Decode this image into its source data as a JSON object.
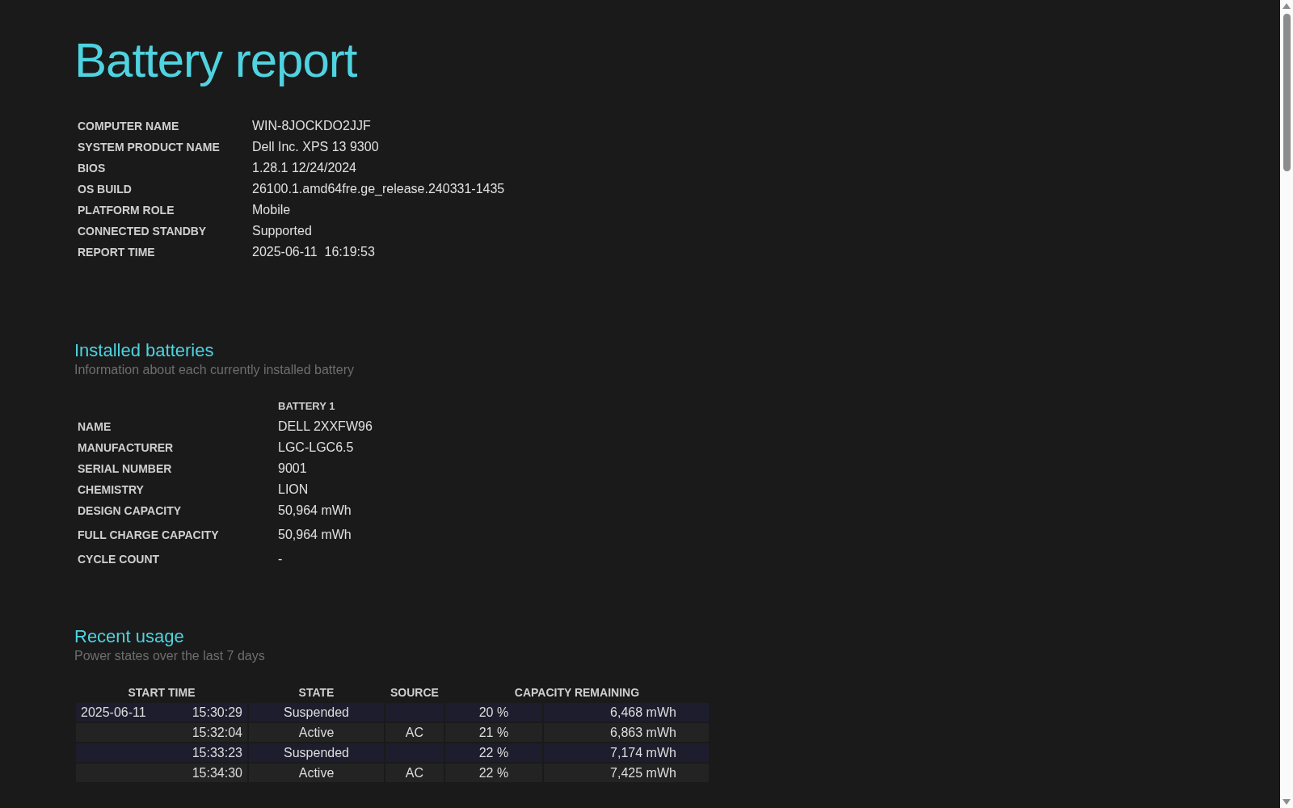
{
  "title": "Battery report",
  "system_info": [
    {
      "label": "COMPUTER NAME",
      "value": "WIN-8JOCKDO2JJF"
    },
    {
      "label": "SYSTEM PRODUCT NAME",
      "value": "Dell Inc. XPS 13 9300"
    },
    {
      "label": "BIOS",
      "value": "1.28.1 12/24/2024"
    },
    {
      "label": "OS BUILD",
      "value": "26100.1.amd64fre.ge_release.240331-1435"
    },
    {
      "label": "PLATFORM ROLE",
      "value": "Mobile"
    },
    {
      "label": "CONNECTED STANDBY",
      "value": "Supported"
    },
    {
      "label": "REPORT TIME",
      "value": "2025-06-11  16:19:53"
    }
  ],
  "installed_batteries": {
    "heading": "Installed batteries",
    "subtitle": "Information about each currently installed battery",
    "column": "BATTERY 1",
    "rows": [
      {
        "label": "NAME",
        "value": "DELL 2XXFW96"
      },
      {
        "label": "MANUFACTURER",
        "value": "LGC-LGC6.5"
      },
      {
        "label": "SERIAL NUMBER",
        "value": "9001"
      },
      {
        "label": "CHEMISTRY",
        "value": "LION"
      },
      {
        "label": "DESIGN CAPACITY",
        "value": "50,964 mWh"
      },
      {
        "label": "FULL CHARGE CAPACITY",
        "value": "50,964 mWh"
      },
      {
        "label": "CYCLE COUNT",
        "value": "-"
      }
    ]
  },
  "recent_usage": {
    "heading": "Recent usage",
    "subtitle": "Power states over the last 7 days",
    "columns": [
      "START TIME",
      "STATE",
      "SOURCE",
      "CAPACITY REMAINING"
    ],
    "rows": [
      {
        "kind": "suspended",
        "date": "2025-06-11",
        "time": "15:30:29",
        "state": "Suspended",
        "source": "",
        "percent": "20 %",
        "energy": "6,468 mWh"
      },
      {
        "kind": "active",
        "date": "",
        "time": "15:32:04",
        "state": "Active",
        "source": "AC",
        "percent": "21 %",
        "energy": "6,863 mWh"
      },
      {
        "kind": "suspended",
        "date": "",
        "time": "15:33:23",
        "state": "Suspended",
        "source": "",
        "percent": "22 %",
        "energy": "7,174 mWh"
      },
      {
        "kind": "active",
        "date": "",
        "time": "15:34:30",
        "state": "Active",
        "source": "AC",
        "percent": "22 %",
        "energy": "7,425 mWh"
      }
    ]
  }
}
